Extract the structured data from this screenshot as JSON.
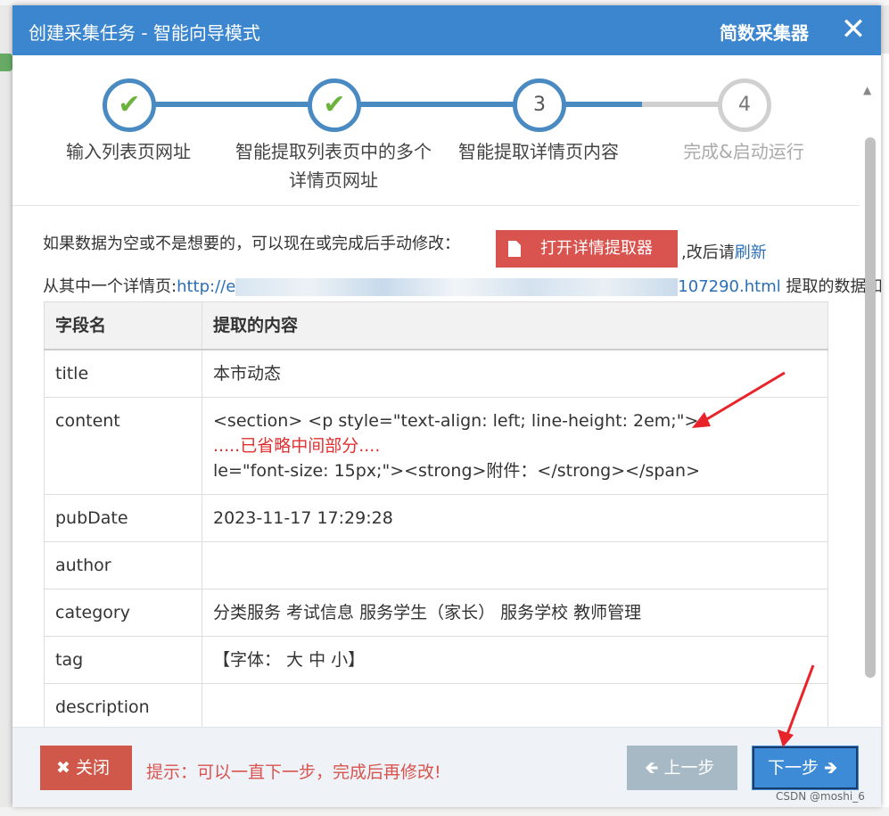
{
  "dialog": {
    "title": "创建采集任务 - 智能向导模式",
    "brand": "简数采集器",
    "close_glyph": "✕"
  },
  "steps": [
    {
      "number": "",
      "label": "输入列表页网址",
      "status": "done"
    },
    {
      "number": "",
      "label": "智能提取列表页中的多个详情页网址",
      "status": "done"
    },
    {
      "number": "3",
      "label": "智能提取详情页内容",
      "status": "active"
    },
    {
      "number": "4",
      "label": "完成&启动运行",
      "status": "pending"
    }
  ],
  "info": {
    "line1_prefix": "如果数据为空或不是想要的，可以现在或完成后手动修改：",
    "open_button": "打开详情提取器",
    "line1_suffix": ",改后请",
    "refresh_link": "刷新",
    "line2_prefix": "从其中一个详情页:",
    "url_start": "http://e",
    "url_end": "107290.html",
    "line2_suffix": " 提取的数据如下:"
  },
  "table": {
    "headers": [
      "字段名",
      "提取的内容"
    ],
    "rows": [
      {
        "field": "title",
        "value": "本市动态"
      },
      {
        "field": "content",
        "value": "<section> <p style=\"text-align: left; line-height: 2em;\">",
        "value2": ".....已省略中间部分....",
        "value3": "le=\"font-size: 15px;\"><strong>附件：</strong></span>"
      },
      {
        "field": "pubDate",
        "value": "2023-11-17 17:29:28"
      },
      {
        "field": "author",
        "value": ""
      },
      {
        "field": "category",
        "value": "分类服务 考试信息 服务学生（家长） 服务学校 教师管理"
      },
      {
        "field": "tag",
        "value": "【字体： 大  中  小】"
      },
      {
        "field": "description",
        "value": ""
      }
    ]
  },
  "footer": {
    "close_label": "关闭",
    "hint": "提示：可以一直下一步，完成后再修改!",
    "prev_label": "上一步",
    "next_label": "下一步"
  },
  "watermark": "CSDN @moshi_6",
  "colors": {
    "titlebar": "#3b86cf",
    "step_done": "#4a8ac2",
    "check": "#6cb33e",
    "danger": "#d9534f",
    "next": "#3d8ad6",
    "annotation": "#e8232a"
  }
}
